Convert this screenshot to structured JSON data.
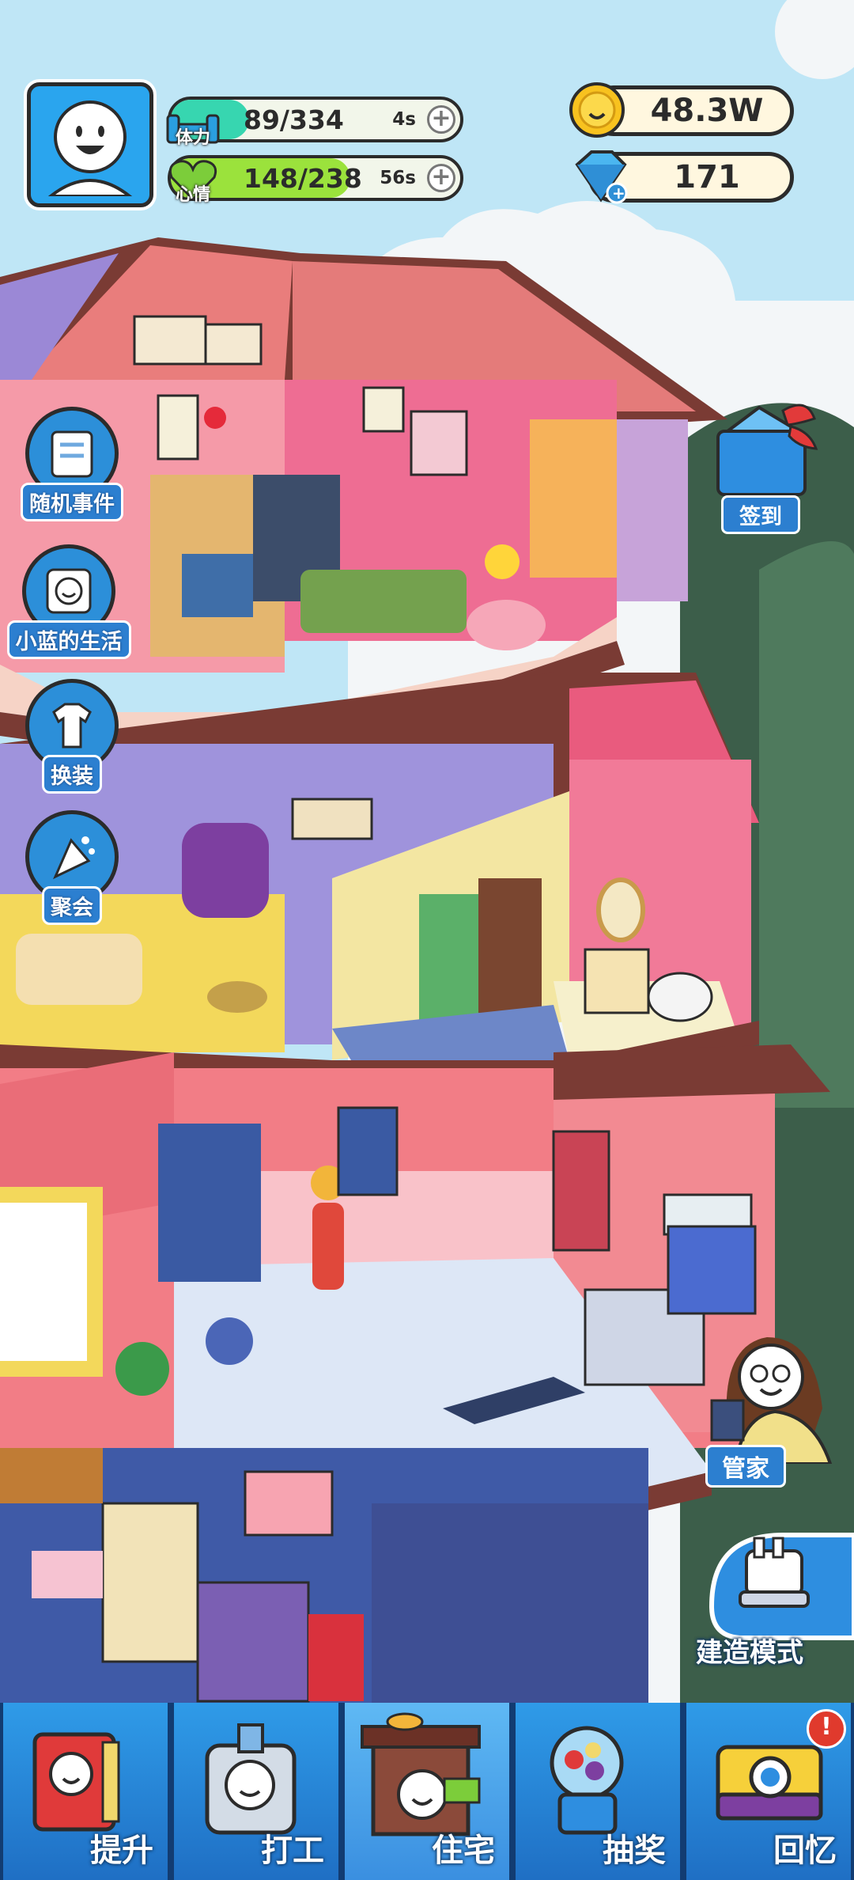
{
  "hud": {
    "stamina": {
      "label": "体力",
      "value": "89/334",
      "timer": "4s",
      "fill_fraction": 0.27,
      "color": "#37d6b0"
    },
    "mood": {
      "label": "心情",
      "value": "148/238",
      "timer": "56s",
      "fill_fraction": 0.62,
      "color": "#9be23c"
    },
    "coins": {
      "value": "48.3W"
    },
    "gems": {
      "value": "171"
    }
  },
  "side_buttons": [
    {
      "id": "random-event",
      "label": "随机事件"
    },
    {
      "id": "xiaolan-life",
      "label": "小蓝的生活"
    },
    {
      "id": "dress-up",
      "label": "换装"
    },
    {
      "id": "party",
      "label": "聚会"
    }
  ],
  "signin": {
    "label": "签到"
  },
  "butler": {
    "label": "管家"
  },
  "build_mode": {
    "label": "建造模式"
  },
  "bottom_nav": [
    {
      "id": "upgrade",
      "label": "提升",
      "icon": "book-icon"
    },
    {
      "id": "work",
      "label": "打工",
      "icon": "work-badge-icon"
    },
    {
      "id": "house",
      "label": "住宅",
      "icon": "house-icon",
      "active": true
    },
    {
      "id": "lottery",
      "label": "抽奖",
      "icon": "gacha-machine-icon"
    },
    {
      "id": "memory",
      "label": "回忆",
      "icon": "camera-icon",
      "badge": "!"
    }
  ],
  "colors": {
    "sky": "#bfe6f6",
    "nav_bg": "#1f6fc4",
    "accent_blue": "#2c8fd9",
    "badge_red": "#e03a2d"
  }
}
